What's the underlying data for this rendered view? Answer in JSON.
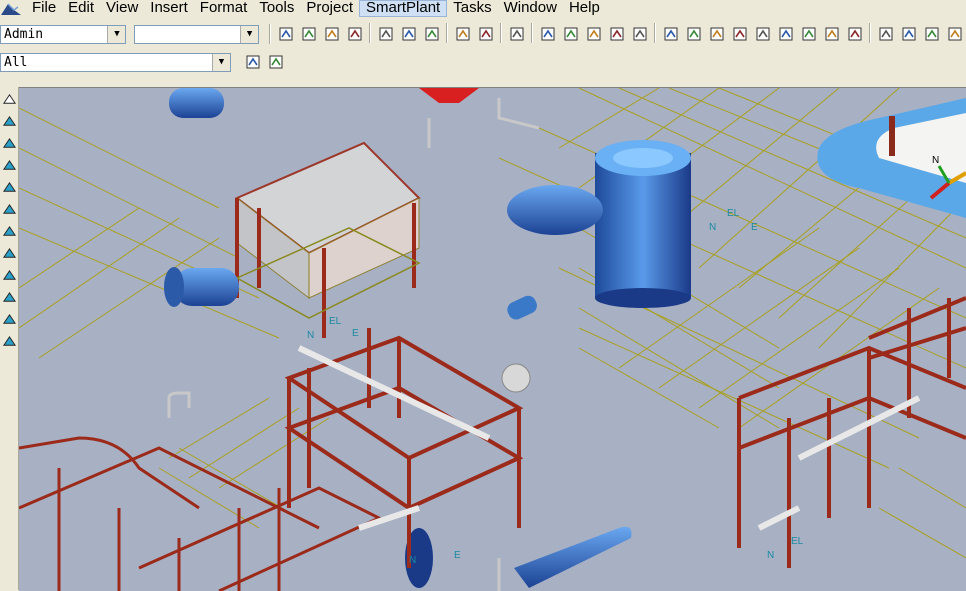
{
  "menu": {
    "items": [
      "File",
      "Edit",
      "View",
      "Insert",
      "Format",
      "Tools",
      "Project",
      "SmartPlant",
      "Tasks",
      "Window",
      "Help"
    ],
    "active": "SmartPlant"
  },
  "toolbar": {
    "user_combo": "Admin",
    "second_combo": "",
    "filter_combo": "All"
  },
  "icons": {
    "row1": [
      "new-file-icon",
      "open-folder-icon",
      "save-icon",
      "refresh-icon",
      "copy-icon",
      "paste-icon",
      "delete-icon",
      "move-icon",
      "rotate-icon",
      "undo-icon",
      "select-tool-icon",
      "measure-icon",
      "pinpoint-icon",
      "grid-icon",
      "ruler-icon",
      "view-iso-icon",
      "view-plan-icon",
      "view-elevation-icon",
      "view-side-icon",
      "fit-view-icon",
      "zoom-area-icon",
      "clip-icon",
      "render-icon",
      "dropdown-icon",
      "zoom-icon",
      "pan-icon",
      "zoom-window-icon",
      "zoom-fit-icon"
    ],
    "row2": [
      "filter-icon",
      "properties-icon"
    ],
    "left": [
      "pointer-icon",
      "structure-icon",
      "equipment-icon",
      "piping-icon",
      "cable-icon",
      "duct-icon",
      "hanger-icon",
      "space-icon",
      "drawing-icon",
      "grid-tool-icon",
      "coordinate-icon",
      "route-icon"
    ]
  },
  "viewport": {
    "compass_labels": [
      "N",
      "EL",
      "E"
    ]
  },
  "colors": {
    "viewport_bg": "#a8b0c4",
    "steel": "#9b2a1a",
    "grid": "#a09a20",
    "equipment": "#3a78c8"
  }
}
